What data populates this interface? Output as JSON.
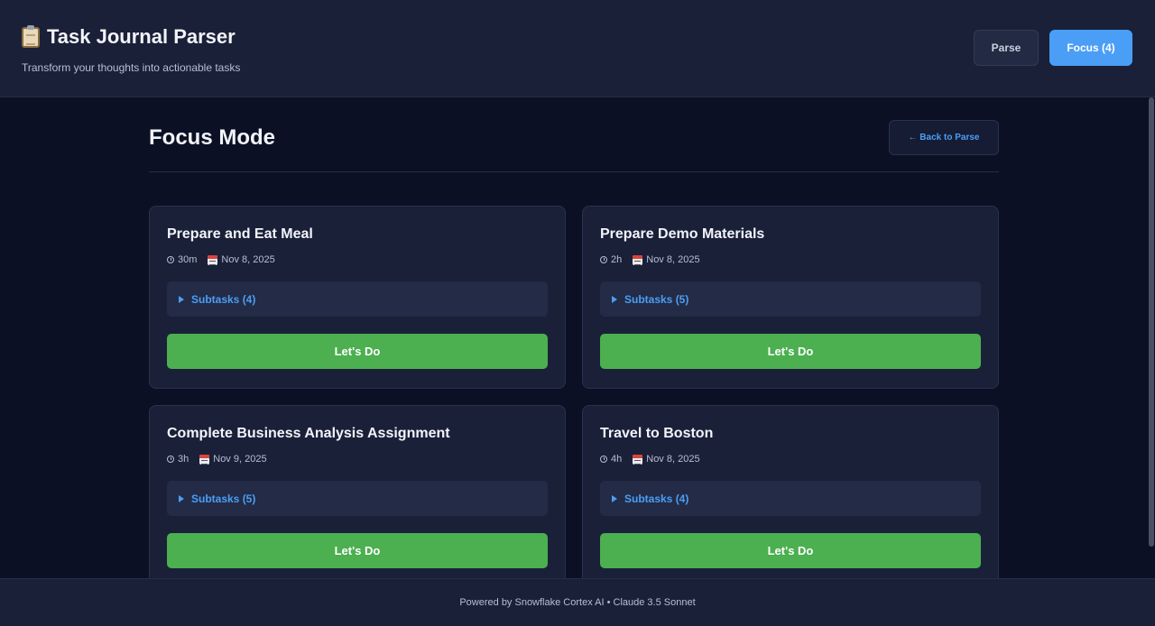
{
  "header": {
    "title": "Task Journal Parser",
    "subtitle": "Transform your thoughts into actionable tasks",
    "parse_label": "Parse",
    "focus_label": "Focus (4)"
  },
  "main": {
    "title": "Focus Mode",
    "back_label": "← Back to Parse",
    "tasks": [
      {
        "title": "Prepare and Eat Meal",
        "duration": "30m",
        "date": "Nov 8, 2025",
        "subtasks_label": "Subtasks (4)",
        "action_label": "Let's Do"
      },
      {
        "title": "Prepare Demo Materials",
        "duration": "2h",
        "date": "Nov 8, 2025",
        "subtasks_label": "Subtasks (5)",
        "action_label": "Let's Do"
      },
      {
        "title": "Complete Business Analysis Assignment",
        "duration": "3h",
        "date": "Nov 9, 2025",
        "subtasks_label": "Subtasks (5)",
        "action_label": "Let's Do"
      },
      {
        "title": "Travel to Boston",
        "duration": "4h",
        "date": "Nov 8, 2025",
        "subtasks_label": "Subtasks (4)",
        "action_label": "Let's Do"
      }
    ]
  },
  "footer": {
    "text": "Powered by Snowflake Cortex AI • Claude 3.5 Sonnet"
  },
  "colors": {
    "background": "#0b1024",
    "panel": "#1a2038",
    "accent": "#4b9ef5",
    "action_green": "#4caf50"
  },
  "icons": {
    "brand": "clipboard-icon",
    "duration": "stopwatch-icon",
    "date": "calendar-icon",
    "expand": "triangle-right-icon"
  }
}
